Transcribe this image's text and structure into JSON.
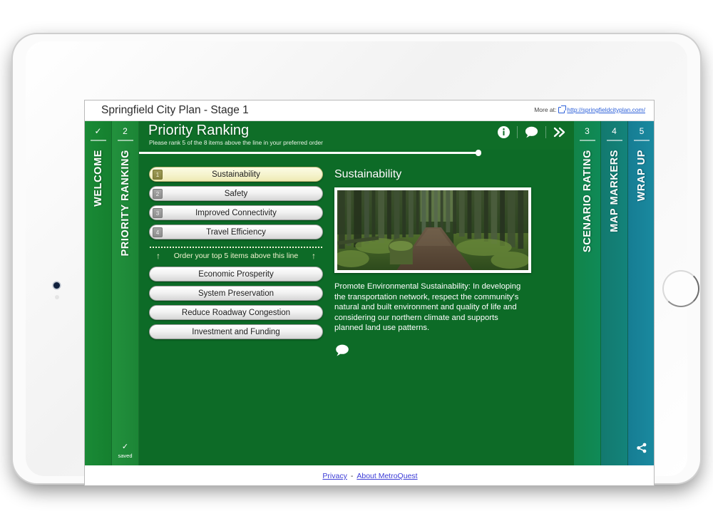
{
  "browser": {
    "page_title": "Springfield City Plan - Stage 1",
    "more_at_label": "More at:",
    "more_at_link": "http://springfieldcityplan.com/",
    "external_link_icon": "external-link-icon"
  },
  "tabs": {
    "left": [
      {
        "number": "✓",
        "label": "WELCOME",
        "color": "#17862f",
        "state": "complete"
      },
      {
        "number": "2",
        "label": "PRIORITY RANKING",
        "color": "#1f8c3a",
        "state": "active",
        "footer_icon": "✓",
        "footer_text": "saved"
      }
    ],
    "right": [
      {
        "number": "3",
        "label": "SCENARIO RATING",
        "color": "#0f8750"
      },
      {
        "number": "4",
        "label": "MAP MARKERS",
        "color": "#137e75"
      },
      {
        "number": "5",
        "label": "WRAP UP",
        "color": "#18849a",
        "footer_icon": "share-icon"
      }
    ]
  },
  "screen_header": {
    "title": "Priority Ranking",
    "subtitle": "Please rank 5 of the 8 items above the line in your preferred order",
    "tools": [
      {
        "icon": "info-icon",
        "name": "info-button"
      },
      {
        "icon": "comment-icon",
        "name": "comment-button"
      },
      {
        "icon": "double-chevron-right-icon",
        "name": "next-button"
      }
    ],
    "progress_percent": 78
  },
  "ranking": {
    "above_line": [
      {
        "rank": "1",
        "label": "Sustainability",
        "selected": true
      },
      {
        "rank": "2",
        "label": "Safety",
        "selected": false
      },
      {
        "rank": "3",
        "label": "Improved Connectivity",
        "selected": false
      },
      {
        "rank": "4",
        "label": "Travel Efficiency",
        "selected": false
      }
    ],
    "divider_hint": "Order your top 5 items above this line",
    "hint_arrow": "↑",
    "below_line": [
      {
        "label": "Economic Prosperity"
      },
      {
        "label": "System Preservation"
      },
      {
        "label": "Reduce Roadway Congestion"
      },
      {
        "label": "Investment and Funding"
      }
    ]
  },
  "detail": {
    "title": "Sustainability",
    "image_alt": "forest-path-photo",
    "description": "Promote Environmental Sustainability: In developing the transportation network, respect the community's natural and built environment and quality of life and considering our northern climate and supports planned land use patterns.",
    "comment_icon": "comment-icon"
  },
  "footer": {
    "privacy_label": "Privacy",
    "separator": "-",
    "about_label": "About MetroQuest"
  },
  "colors": {
    "panel_green": "#0d6b27",
    "header_green": "#0f6e28",
    "selected_item": "#f6f4cf",
    "link_blue": "#3a3ad6"
  }
}
